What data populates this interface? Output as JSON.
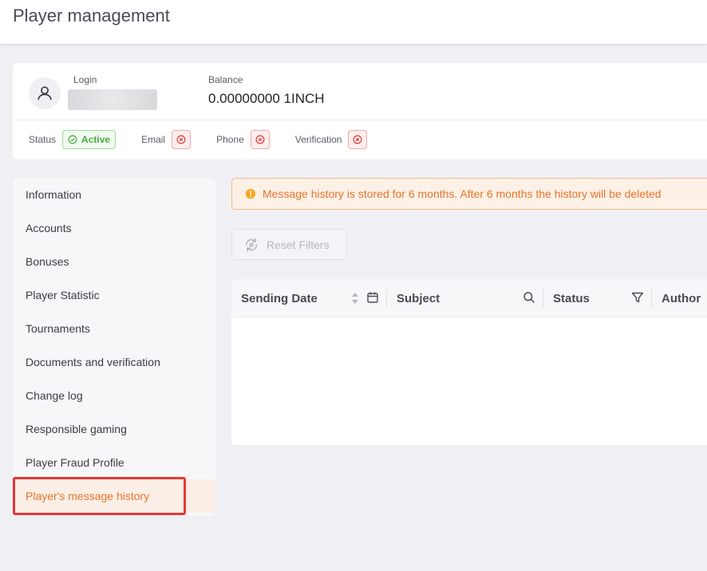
{
  "header": {
    "title": "Player management"
  },
  "player": {
    "login_label": "Login",
    "balance_label": "Balance",
    "balance_value": "0.00000000 1INCH",
    "status_label": "Status",
    "status_value": "Active",
    "email_label": "Email",
    "phone_label": "Phone",
    "verification_label": "Verification"
  },
  "sidebar": {
    "items": [
      {
        "label": "Information"
      },
      {
        "label": "Accounts"
      },
      {
        "label": "Bonuses"
      },
      {
        "label": "Player Statistic"
      },
      {
        "label": "Tournaments"
      },
      {
        "label": "Documents and verification"
      },
      {
        "label": "Change log"
      },
      {
        "label": "Responsible gaming"
      },
      {
        "label": "Player Fraud Profile"
      },
      {
        "label": "Player's message history"
      }
    ],
    "active_index": 9
  },
  "main": {
    "alert_text": "Message history is stored for 6 months. After 6 months the history will be deleted",
    "reset_label": "Reset Filters",
    "table": {
      "columns": [
        {
          "label": "Sending Date"
        },
        {
          "label": "Subject"
        },
        {
          "label": "Status"
        },
        {
          "label": "Author"
        }
      ]
    }
  },
  "colors": {
    "accent": "#e8742a",
    "active_green": "#4caa45",
    "error_red": "#e53935"
  }
}
